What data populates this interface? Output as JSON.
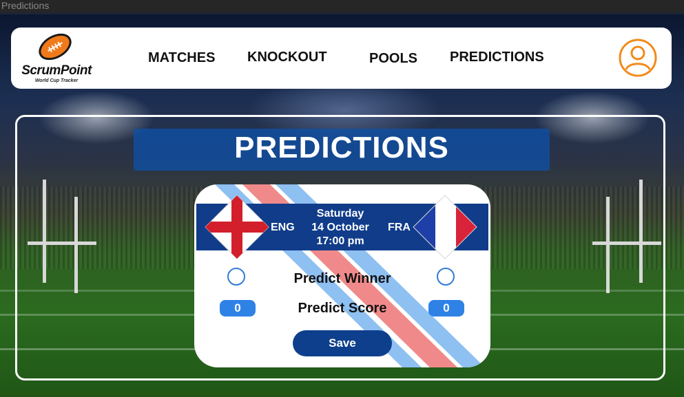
{
  "window": {
    "title": "Predictions"
  },
  "brand": {
    "name": "ScrumPoint",
    "tagline": "World Cup Tracker"
  },
  "nav": {
    "matches": "MATCHES",
    "knockout": "KNOCKOUT",
    "pools": "POOLS",
    "predictions": "PREDICTIONS"
  },
  "page": {
    "title": "PREDICTIONS"
  },
  "match": {
    "home": {
      "abbr": "ENG",
      "flag": "england-flag-icon"
    },
    "away": {
      "abbr": "FRA",
      "flag": "france-flag-icon"
    },
    "day": "Saturday",
    "date": "14 October",
    "time": "17:00 pm"
  },
  "predict": {
    "winner_label": "Predict Winner",
    "score_label": "Predict Score",
    "home_score": "0",
    "away_score": "0",
    "save_label": "Save"
  },
  "colors": {
    "accent_orange": "#f28a1a",
    "band_blue": "#103c8a",
    "score_blue": "#2e82e6",
    "stripe_red": "#f08a8a",
    "stripe_blue": "#8ec0f2"
  }
}
